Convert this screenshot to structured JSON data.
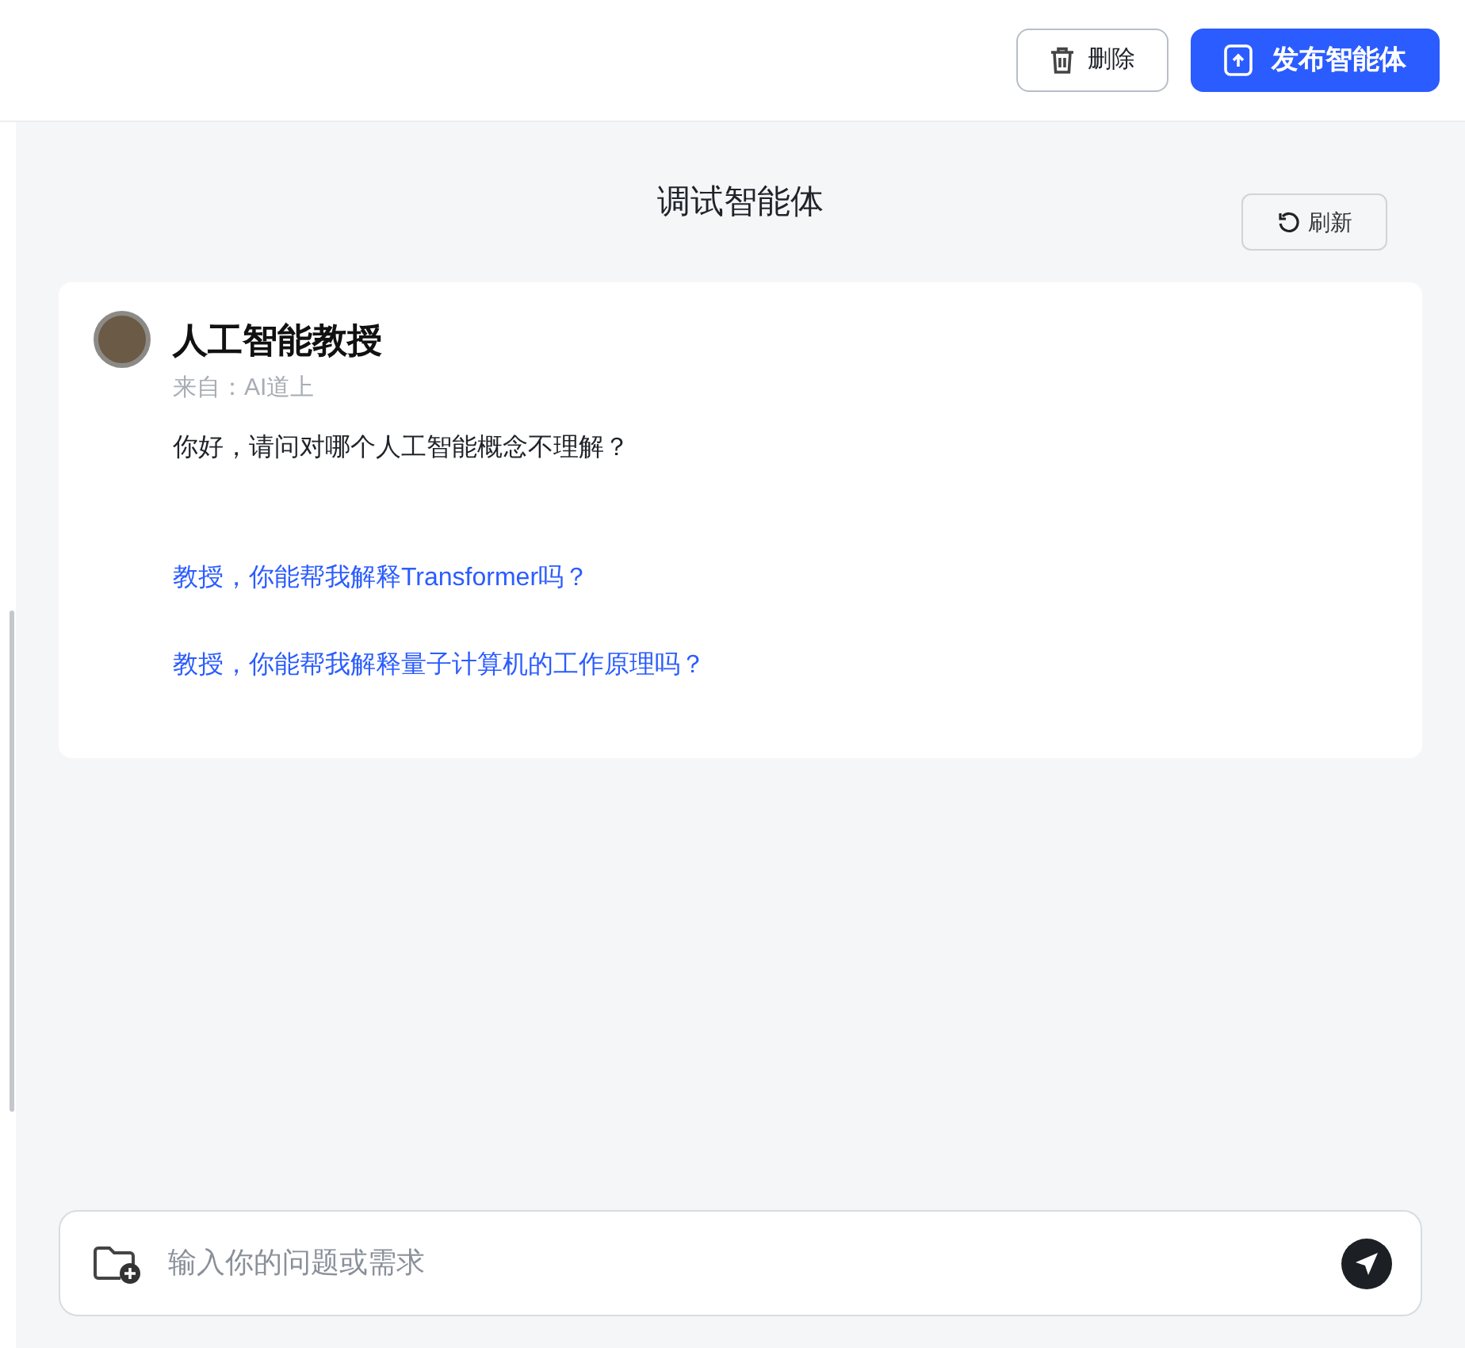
{
  "header": {
    "buttons": [
      {
        "kind": "delete",
        "label": "删除"
      },
      {
        "kind": "publish",
        "label": "发布智能体"
      }
    ]
  },
  "debug_panel": {
    "title": "调试智能体",
    "refresh_label": "刷新"
  },
  "agent": {
    "name": "人工智能教授",
    "source": "来自：AI道上",
    "greeting": "你好，请问对哪个人工智能概念不理解？",
    "suggestions": [
      "教授，你能帮我解释Transformer吗？",
      "教授，你能帮我解释量子计算机的工作原理吗？"
    ]
  },
  "composer": {
    "placeholder": "输入你的问题或需求"
  }
}
